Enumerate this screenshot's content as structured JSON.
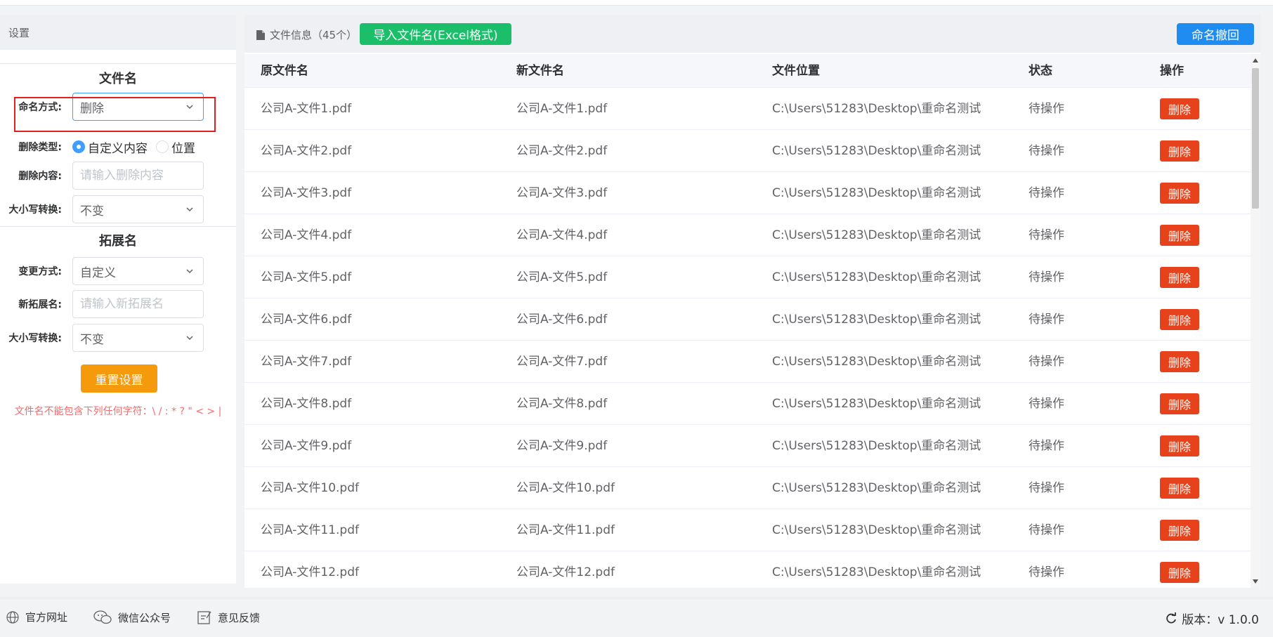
{
  "left_panel": {
    "header": "设置",
    "filename_section": "文件名",
    "naming_mode": {
      "label": "命名方式:",
      "value": "删除"
    },
    "delete_type": {
      "label": "删除类型:",
      "option_custom": "自定义内容",
      "option_position": "位置",
      "selected": "自定义内容"
    },
    "delete_content": {
      "label": "删除内容:",
      "placeholder": "请输入删除内容",
      "value": ""
    },
    "case_convert": {
      "label": "大小写转换:",
      "value": "不变"
    },
    "ext_section": "拓展名",
    "change_mode": {
      "label": "变更方式:",
      "value": "自定义"
    },
    "new_ext": {
      "label": "新拓展名:",
      "placeholder": "请输入新拓展名",
      "value": ""
    },
    "ext_case_convert": {
      "label": "大小写转换:",
      "value": "不变"
    },
    "reset_button": "重置设置",
    "warning": "文件名不能包含下列任何字符：\\ / : * ? \" < > |"
  },
  "right_panel": {
    "file_info": "文件信息（45个）",
    "import_button": "导入文件名(Excel格式)",
    "undo_button": "命名撤回",
    "columns": [
      "原文件名",
      "新文件名",
      "文件位置",
      "状态",
      "操作"
    ],
    "rows": [
      {
        "orig": "公司A-文件1.pdf",
        "new": "公司A-文件1.pdf",
        "path": "C:\\Users\\51283\\Desktop\\重命名测试",
        "status": "待操作",
        "action": "删除"
      },
      {
        "orig": "公司A-文件2.pdf",
        "new": "公司A-文件2.pdf",
        "path": "C:\\Users\\51283\\Desktop\\重命名测试",
        "status": "待操作",
        "action": "删除"
      },
      {
        "orig": "公司A-文件3.pdf",
        "new": "公司A-文件3.pdf",
        "path": "C:\\Users\\51283\\Desktop\\重命名测试",
        "status": "待操作",
        "action": "删除"
      },
      {
        "orig": "公司A-文件4.pdf",
        "new": "公司A-文件4.pdf",
        "path": "C:\\Users\\51283\\Desktop\\重命名测试",
        "status": "待操作",
        "action": "删除"
      },
      {
        "orig": "公司A-文件5.pdf",
        "new": "公司A-文件5.pdf",
        "path": "C:\\Users\\51283\\Desktop\\重命名测试",
        "status": "待操作",
        "action": "删除"
      },
      {
        "orig": "公司A-文件6.pdf",
        "new": "公司A-文件6.pdf",
        "path": "C:\\Users\\51283\\Desktop\\重命名测试",
        "status": "待操作",
        "action": "删除"
      },
      {
        "orig": "公司A-文件7.pdf",
        "new": "公司A-文件7.pdf",
        "path": "C:\\Users\\51283\\Desktop\\重命名测试",
        "status": "待操作",
        "action": "删除"
      },
      {
        "orig": "公司A-文件8.pdf",
        "new": "公司A-文件8.pdf",
        "path": "C:\\Users\\51283\\Desktop\\重命名测试",
        "status": "待操作",
        "action": "删除"
      },
      {
        "orig": "公司A-文件9.pdf",
        "new": "公司A-文件9.pdf",
        "path": "C:\\Users\\51283\\Desktop\\重命名测试",
        "status": "待操作",
        "action": "删除"
      },
      {
        "orig": "公司A-文件10.pdf",
        "new": "公司A-文件10.pdf",
        "path": "C:\\Users\\51283\\Desktop\\重命名测试",
        "status": "待操作",
        "action": "删除"
      },
      {
        "orig": "公司A-文件11.pdf",
        "new": "公司A-文件11.pdf",
        "path": "C:\\Users\\51283\\Desktop\\重命名测试",
        "status": "待操作",
        "action": "删除"
      },
      {
        "orig": "公司A-文件12.pdf",
        "new": "公司A-文件12.pdf",
        "path": "C:\\Users\\51283\\Desktop\\重命名测试",
        "status": "待操作",
        "action": "删除"
      }
    ]
  },
  "footer": {
    "website": "官方网址",
    "wechat": "微信公众号",
    "feedback": "意见反馈",
    "version": "版本：v 1.0.0"
  },
  "colors": {
    "import_green": "#1bbf6a",
    "undo_blue": "#1e8cf0",
    "delete_red": "#e6431c",
    "reset_orange": "#f59a0c",
    "highlight_red": "#e02020",
    "warning_red": "#f56c6c"
  }
}
